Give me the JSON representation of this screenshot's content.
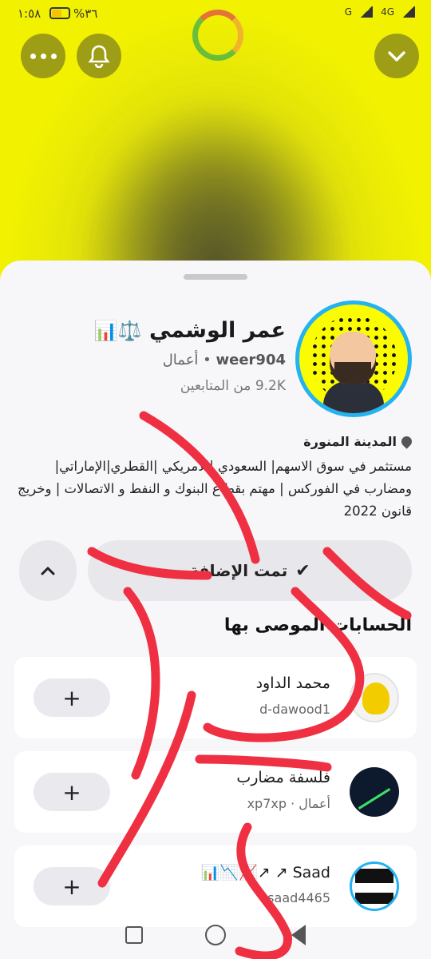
{
  "status_bar": {
    "time": "١:٥٨",
    "battery_percent": "%٣٦",
    "network_1": "G",
    "network_2": "4G"
  },
  "header": {
    "more_icon": "more-horizontal-icon",
    "bell_icon": "bell-icon",
    "collapse_icon": "chevron-down-icon"
  },
  "profile": {
    "name": "عمر الوشمي",
    "name_emoji": "⚖️📊",
    "username": "weer904",
    "separator": " • ",
    "category": "أعمال",
    "followers": "9.2K من المتابعين",
    "location": "المدينة المنورة",
    "bio": "مستثمر في سوق الاسهم| السعودي |الامريكي |القطري|الإماراتي| ومضارب في الفوركس | مهتم بقطاع البنوك و النفط و الاتصالات | وخريج قانون 2022"
  },
  "actions": {
    "added_label": "تمت الإضافة",
    "added_icon": "checkmark-icon",
    "expand_icon": "chevron-up-icon"
  },
  "recommended": {
    "title": "الحسابات الموصى بها",
    "items": [
      {
        "title": "محمد الداود",
        "handle": "d-dawood1",
        "add": "+"
      },
      {
        "title": "فلسفة مضارب",
        "handle": "أعمال · xp7xp",
        "add": "+"
      },
      {
        "title": "Saad ↗ ↗📈📉📊",
        "handle": "saad4465",
        "add": "+"
      }
    ]
  },
  "colors": {
    "snap_yellow": "#fbfc00",
    "ring_blue": "#23b2f2",
    "scribble_red": "#ee3042"
  }
}
